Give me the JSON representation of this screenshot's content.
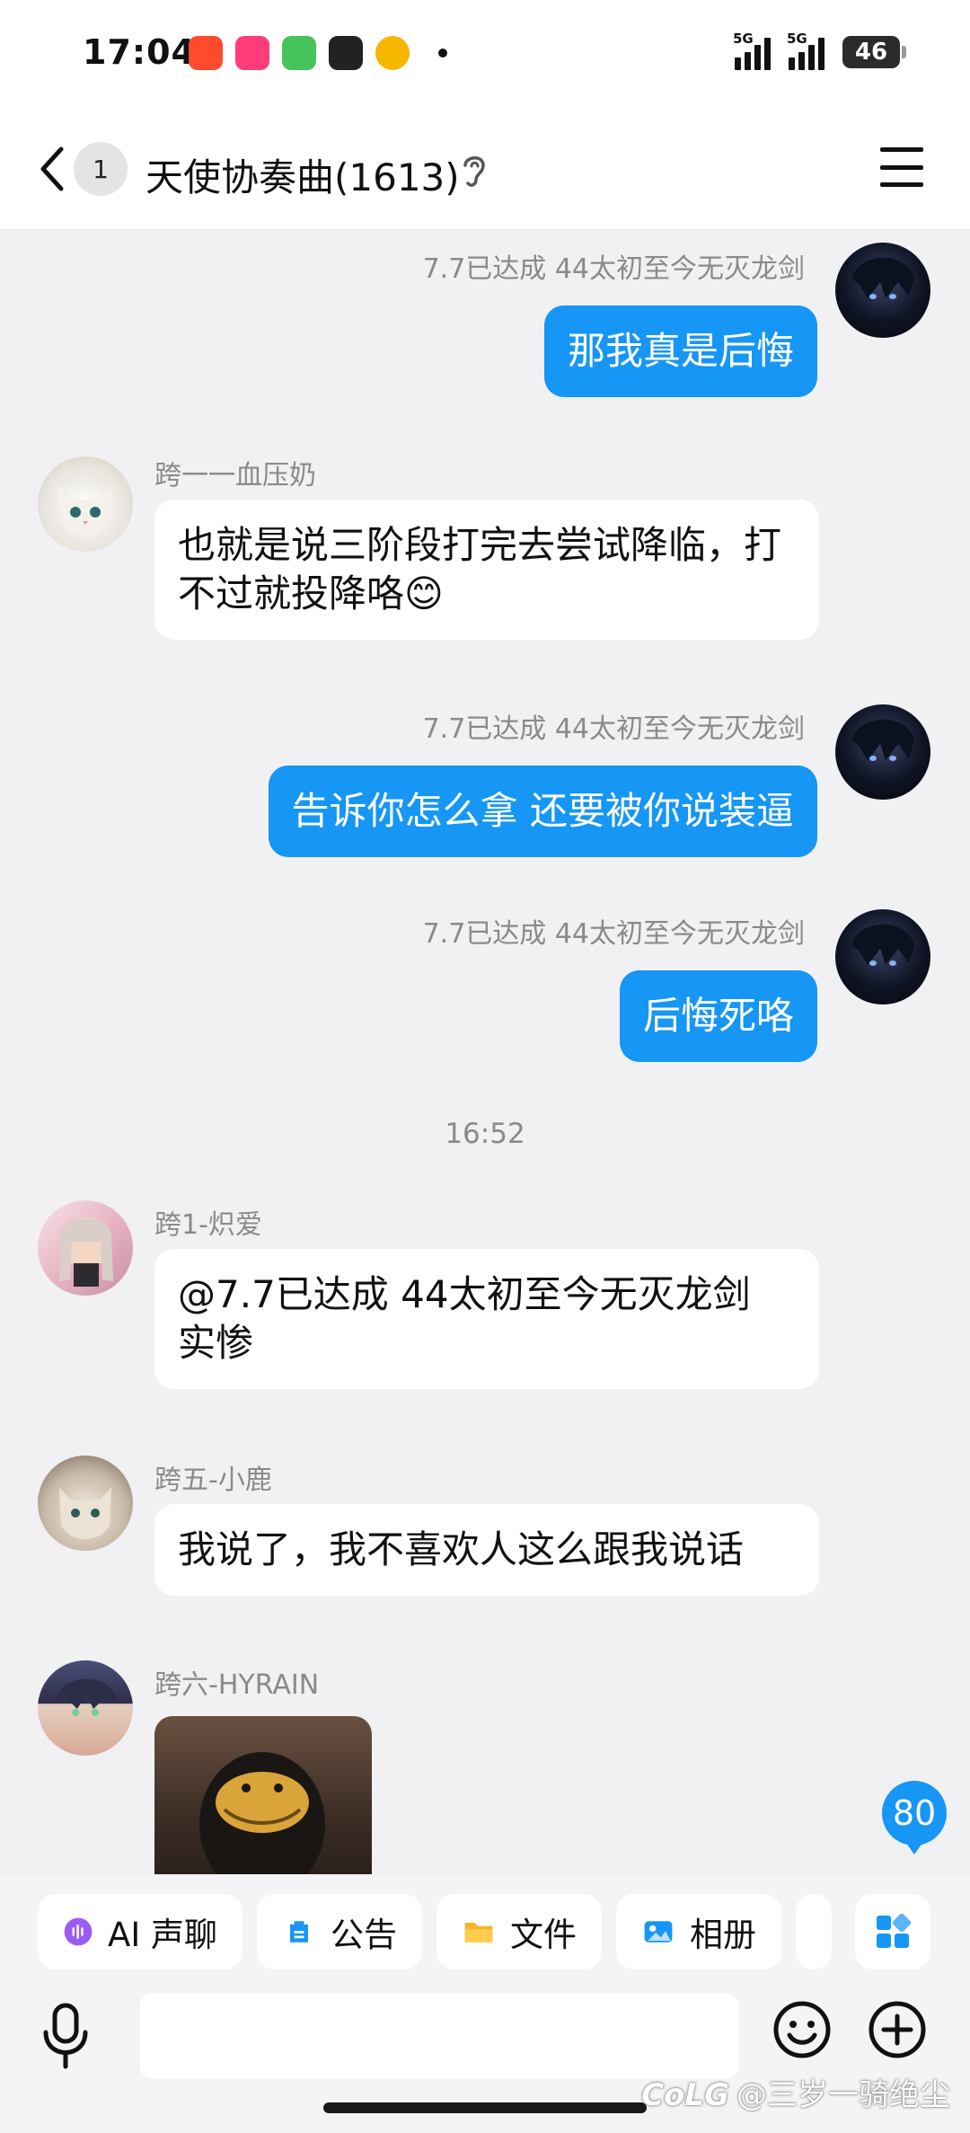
{
  "status_bar": {
    "time": "17:04",
    "network_1": "5G",
    "network_2": "5G",
    "battery": "46"
  },
  "header": {
    "unread_count": "1",
    "title": "天使协奏曲(1613)"
  },
  "messages": [
    {
      "sender": "7.7已达成   44太初至今无灭龙剑",
      "text": "那我真是后悔",
      "mine": true
    },
    {
      "sender": "跨一一血压奶",
      "text": "也就是说三阶段打完去尝试降临，打不过就投降咯😊",
      "mine": false
    },
    {
      "sender": "7.7已达成   44太初至今无灭龙剑",
      "text": "告诉你怎么拿 还要被你说装逼",
      "mine": true
    },
    {
      "sender": "7.7已达成   44太初至今无灭龙剑",
      "text": "后悔死咯",
      "mine": true
    },
    {
      "sender": "跨1-炽爱",
      "text": "@7.7已达成   44太初至今无灭龙剑 实惨",
      "mine": false
    },
    {
      "sender": "跨五-小鹿",
      "text": "我说了，我不喜欢人这么跟我说话",
      "mine": false
    },
    {
      "sender": "跨六-HYRAIN",
      "text": "",
      "mine": false
    }
  ],
  "time_separator": "16:52",
  "new_message_count": "80",
  "quick_actions": [
    {
      "label": "AI 声聊"
    },
    {
      "label": "公告"
    },
    {
      "label": "文件"
    },
    {
      "label": "相册"
    }
  ],
  "input": {
    "value": "",
    "placeholder": ""
  },
  "watermark": "@三岁一骑绝尘",
  "watermark_logo": "CoLG",
  "colors": {
    "accent": "#1696f5",
    "background": "#f1f1f3",
    "bubble_other": "#ffffff"
  }
}
